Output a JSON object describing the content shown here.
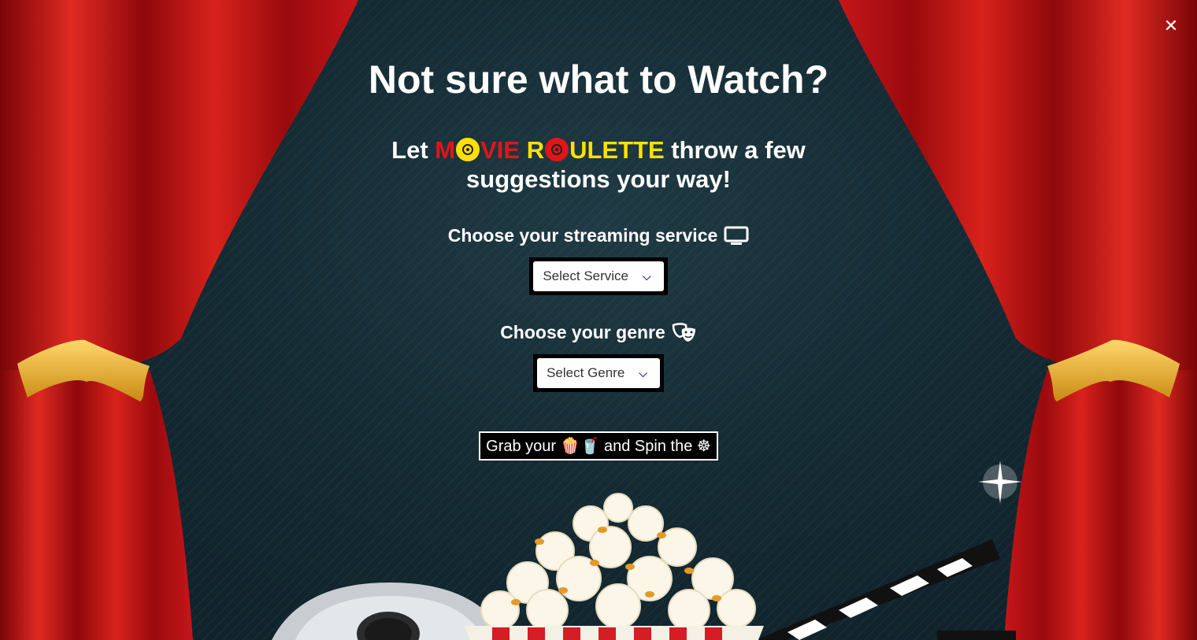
{
  "close_label": "✕",
  "title": "Not sure what to Watch?",
  "subtitle": {
    "prefix": "Let ",
    "brand_part1": "M",
    "brand_part2": "VIE ",
    "brand_part3": "R",
    "brand_part4": "ULETTE",
    "suffix": " throw a few suggestions your way!"
  },
  "streaming": {
    "label": "Choose your streaming service",
    "icon": "tv-icon",
    "select_value": "Select Service"
  },
  "genre": {
    "label": "Choose your genre",
    "icon": "theater-masks-icon",
    "select_value": "Select Genre"
  },
  "spin_button": {
    "text_a": "Grab your ",
    "emoji_popcorn": "🍿",
    "emoji_drink": "🥤",
    "text_b": " and Spin the ",
    "emoji_wheel": "☸"
  },
  "colors": {
    "brand_red": "#e01616",
    "brand_yellow": "#ffe000",
    "chevron_blue": "#2b34b8",
    "curtain_red": "#c4141a"
  }
}
